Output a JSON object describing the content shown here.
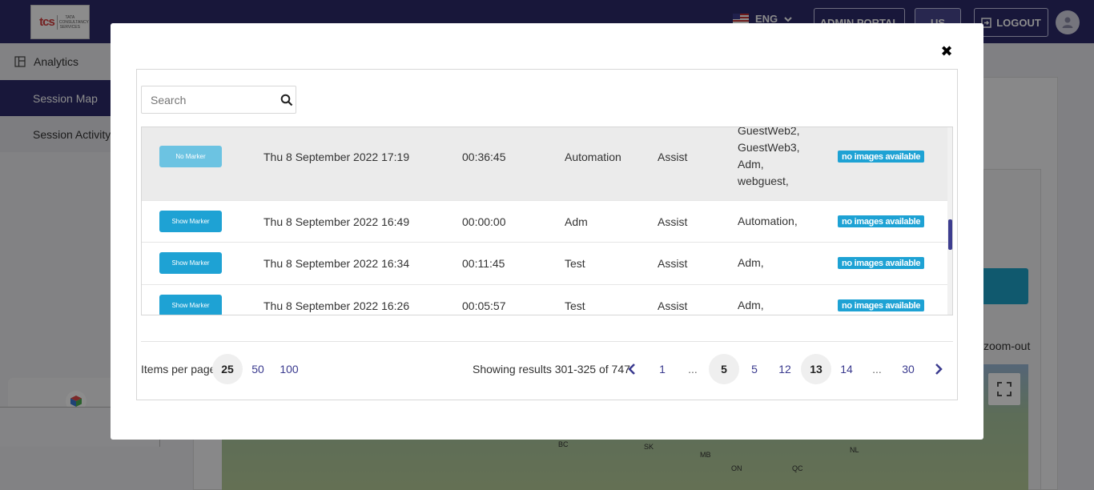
{
  "header": {
    "logo_text": "tcs",
    "logo_subtext": "TATA CONSULTANCY SERVICES",
    "language": "ENG",
    "admin_portal_label": "ADMIN PORTAL",
    "us_label": "US",
    "logout_label": "LOGOUT"
  },
  "sidebar": {
    "items": [
      {
        "label": "Analytics"
      },
      {
        "label": "Session Map"
      },
      {
        "label": "Session Activity"
      }
    ],
    "collapse_glyph": "‹"
  },
  "background": {
    "zoom_out_label": "zoom-out",
    "map_labels": [
      "BC",
      "SK",
      "MB",
      "NL",
      "ON",
      "QC"
    ]
  },
  "modal": {
    "close_glyph": "✖",
    "search": {
      "placeholder": "Search",
      "value": ""
    },
    "rows": [
      {
        "marker_label": "No Marker",
        "date": "Thu 8 September 2022 17:19",
        "duration": "00:36:45",
        "host": "Automation",
        "type": "Assist",
        "participants": [
          "GuestWeb2,",
          "GuestWeb3,",
          "Adm,",
          "webguest,"
        ],
        "images": "no images available"
      },
      {
        "marker_label": "Show Marker",
        "date": "Thu 8 September 2022 16:49",
        "duration": "00:00:00",
        "host": "Adm",
        "type": "Assist",
        "participants": [
          "Automation,"
        ],
        "images": "no images available"
      },
      {
        "marker_label": "Show Marker",
        "date": "Thu 8 September 2022 16:34",
        "duration": "00:11:45",
        "host": "Test",
        "type": "Assist",
        "participants": [
          "Adm,"
        ],
        "images": "no images available"
      },
      {
        "marker_label": "Show Marker",
        "date": "Thu 8 September 2022 16:26",
        "duration": "00:05:57",
        "host": "Test",
        "type": "Assist",
        "participants": [
          "Adm,"
        ],
        "images": "no images available"
      }
    ],
    "pagination": {
      "items_per_page_label": "Items per page:",
      "page_sizes": [
        "25",
        "50",
        "100"
      ],
      "selected_page_size": "25",
      "showing_text": "Showing results 301-325 of 747",
      "pages": [
        "1",
        "...",
        "5",
        "5",
        "12",
        "13",
        "14",
        "...",
        "30"
      ],
      "current_page": "13"
    }
  },
  "colors": {
    "brand": "#2c2a6b",
    "button_blue": "#1ea2d4",
    "badge_blue": "#1ea2d4",
    "pager_link": "#3b3b8f"
  }
}
